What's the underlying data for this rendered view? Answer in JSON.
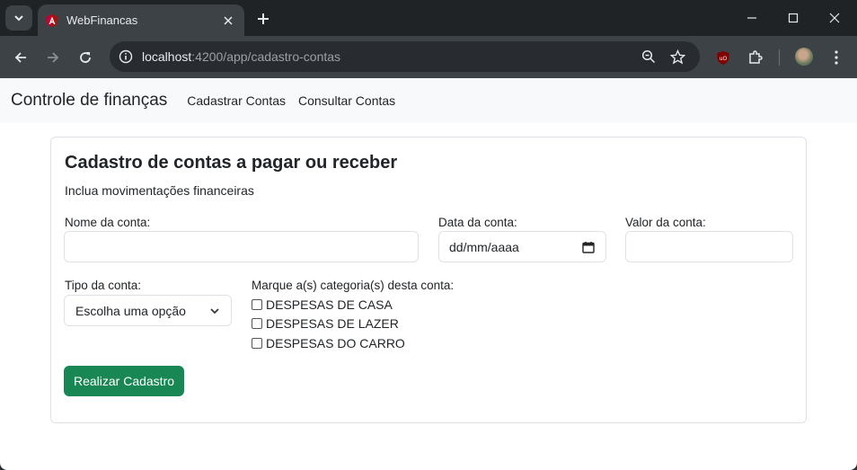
{
  "browser": {
    "tab_title": "WebFinancas",
    "url_host": "localhost",
    "url_path": ":4200/app/cadastro-contas"
  },
  "navbar": {
    "brand": "Controle de finanças",
    "links": [
      "Cadastrar Contas",
      "Consultar Contas"
    ]
  },
  "form": {
    "title": "Cadastro de contas a pagar ou receber",
    "subtitle": "Inclua movimentações financeiras",
    "nome_label": "Nome da conta:",
    "nome_value": "",
    "data_label": "Data da conta:",
    "data_placeholder": "dd/mm/aaaa",
    "valor_label": "Valor da conta:",
    "valor_value": "",
    "tipo_label": "Tipo da conta:",
    "tipo_selected": "Escolha uma opção",
    "categorias_label": "Marque a(s) categoria(s) desta conta:",
    "categorias": [
      "DESPESAS DE CASA",
      "DESPESAS DE LAZER",
      "DESPESAS DO CARRO"
    ],
    "submit_label": "Realizar Cadastro"
  },
  "colors": {
    "primary_button": "#198754",
    "navbar_bg": "#f8f9fa",
    "chrome_bg": "#3c4246"
  }
}
